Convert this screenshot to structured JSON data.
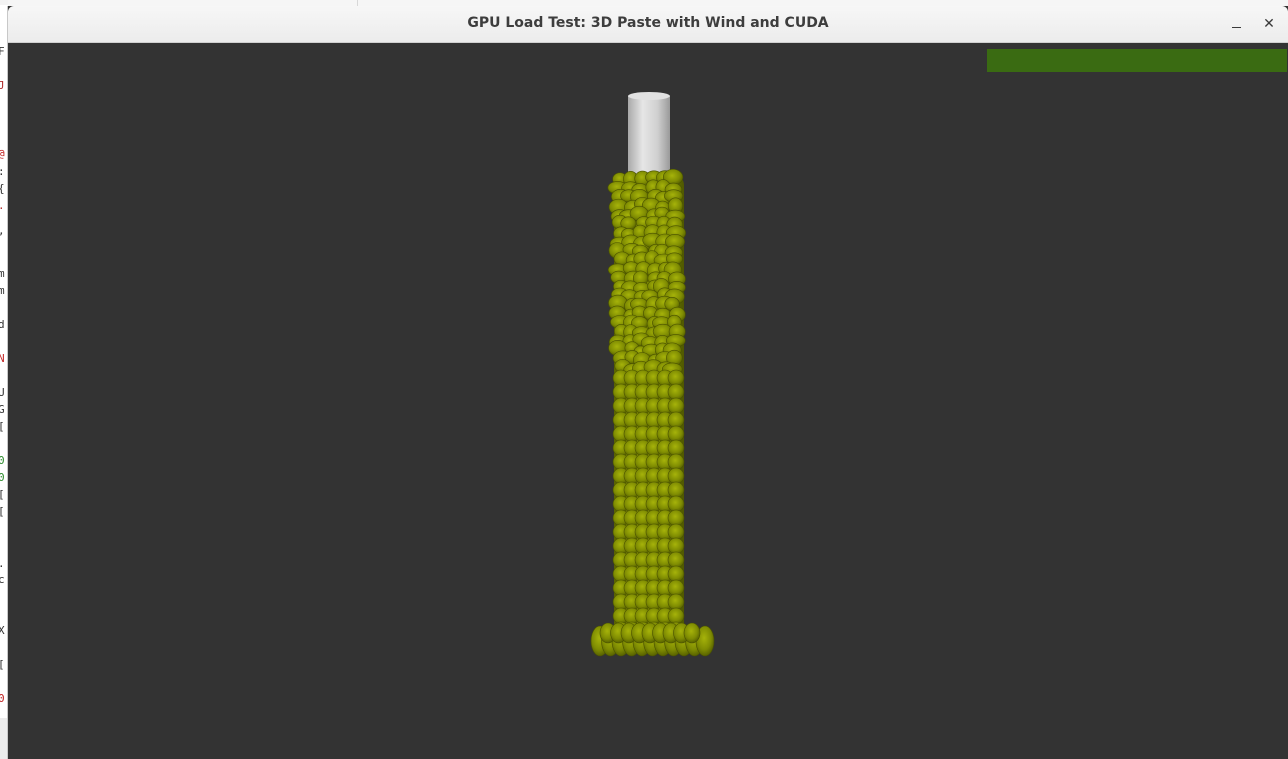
{
  "window": {
    "title": "GPU Load Test: 3D Paste with Wind and CUDA",
    "minimize_symbol": "–",
    "close_symbol": "✕"
  },
  "gpu_load": {
    "fraction": 1.0,
    "color": "#3a6b12"
  },
  "scene": {
    "background_color": "#333333",
    "nozzle_color": "#d4d4d4",
    "paste_color": "#7a8a00",
    "paste_highlight": "#97a80a"
  },
  "icons": [
    "minimize-icon",
    "close-icon"
  ]
}
